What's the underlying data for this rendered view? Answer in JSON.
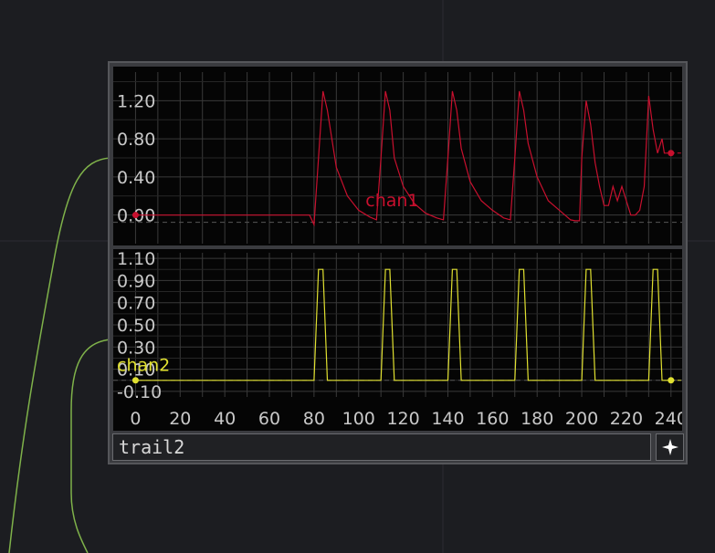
{
  "operator": {
    "name": "trail2",
    "viewer_toggle_icon": "sparkle-star-icon"
  },
  "colors": {
    "background": "#1c1d21",
    "wire": "#7fb24a",
    "chan1": "#c8102e",
    "chan2": "#e0e030",
    "grid": "#3a3a3a",
    "label": "#c8c8c8"
  },
  "chart_data": [
    {
      "type": "line",
      "series": [
        {
          "name": "chan1",
          "x": [
            0,
            78,
            80,
            82,
            84,
            86,
            90,
            95,
            100,
            105,
            108,
            110,
            112,
            114,
            116,
            120,
            125,
            130,
            135,
            138,
            140,
            142,
            144,
            146,
            150,
            155,
            160,
            165,
            168,
            170,
            172,
            174,
            176,
            180,
            185,
            190,
            195,
            197,
            199,
            200,
            202,
            204,
            206,
            208,
            210,
            212,
            214,
            216,
            218,
            220,
            222,
            224,
            226,
            228,
            230,
            232,
            234,
            236,
            237,
            240
          ],
          "y": [
            0,
            0,
            -0.1,
            0.6,
            1.3,
            1.1,
            0.5,
            0.2,
            0.05,
            -0.02,
            -0.05,
            0.6,
            1.3,
            1.1,
            0.6,
            0.3,
            0.12,
            0.02,
            -0.03,
            -0.05,
            0.6,
            1.3,
            1.1,
            0.7,
            0.35,
            0.15,
            0.05,
            -0.03,
            -0.05,
            0.6,
            1.3,
            1.1,
            0.75,
            0.4,
            0.15,
            0.05,
            -0.05,
            -0.06,
            -0.06,
            0.6,
            1.2,
            0.95,
            0.55,
            0.3,
            0.1,
            0.1,
            0.3,
            0.15,
            0.3,
            0.15,
            0.0,
            0.0,
            0.05,
            0.3,
            1.25,
            0.9,
            0.65,
            0.8,
            0.65,
            0.65
          ]
        }
      ],
      "ylim": [
        -0.3,
        1.5
      ],
      "xlim": [
        -10,
        245
      ],
      "yticks": [
        "1.20",
        "0.80",
        "0.40",
        "0.00"
      ]
    },
    {
      "type": "line",
      "series": [
        {
          "name": "chan2",
          "x": [
            0,
            80,
            82,
            83,
            84,
            86,
            110,
            112,
            113,
            114,
            116,
            140,
            142,
            143,
            144,
            146,
            170,
            172,
            173,
            174,
            176,
            200,
            202,
            203,
            204,
            206,
            230,
            232,
            233,
            234,
            236,
            240
          ],
          "y": [
            0,
            0,
            1,
            1,
            1,
            0,
            0,
            1,
            1,
            1,
            0,
            0,
            1,
            1,
            1,
            0,
            0,
            1,
            1,
            1,
            0,
            0,
            1,
            1,
            1,
            0,
            0,
            1,
            1,
            1,
            0,
            0
          ]
        }
      ],
      "ylim": [
        -0.15,
        1.15
      ],
      "xlim": [
        -10,
        245
      ],
      "yticks": [
        "1.10",
        "0.90",
        "0.70",
        "0.50",
        "0.30",
        "0.10",
        "-0.10"
      ],
      "xticks": [
        "0",
        "20",
        "40",
        "60",
        "80",
        "100",
        "120",
        "140",
        "160",
        "180",
        "200",
        "220",
        "240"
      ]
    }
  ]
}
